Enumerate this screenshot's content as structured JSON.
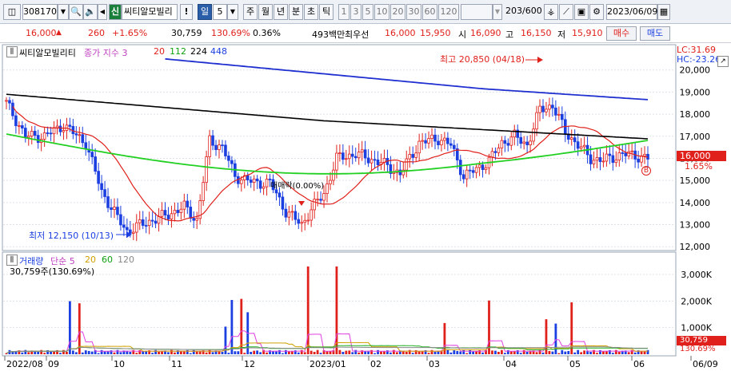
{
  "toolbar": {
    "code": "308170",
    "search_glyph": "🔍",
    "sound_glyph": "🔈",
    "arrow_glyph": "◀",
    "badge": "신",
    "stock_name": "씨티알모빌리",
    "excl": "!",
    "period_label": "일",
    "period_value": "5",
    "dropdown_glyph": "▼",
    "periods": [
      "주",
      "월",
      "년",
      "분",
      "초",
      "틱"
    ],
    "intervals": [
      "1",
      "3",
      "5",
      "10",
      "20",
      "30",
      "60",
      "120"
    ],
    "count": "203",
    "count_total": "/600",
    "date": "2023/06/09",
    "calendar_glyph": "▦"
  },
  "quote": {
    "price": "16,000",
    "up_glyph": "▲",
    "change": "260",
    "change_pct": "+1.65%",
    "volume": "30,759",
    "volume_ratio": "130.69%",
    "turnover": "0.36%",
    "value": "493백만",
    "pref_label": "최우선",
    "ask": "16,000",
    "bid": "15,950",
    "open_label": "시",
    "open": "16,090",
    "high_label": "고",
    "high": "16,150",
    "low_label": "저",
    "low": "15,910",
    "buy": "매수",
    "sell": "매도"
  },
  "price_panel": {
    "legend_name": "씨티알모빌리티",
    "legend_ma_label": "종가 지수 3",
    "ma_periods": [
      "20",
      "112",
      "224",
      "448"
    ],
    "lc": "LC:31.69",
    "hc": "HC:-23.26",
    "high_annot": "최고 20,850 (04/18)",
    "low_annot": "최저 12,150 (10/13)",
    "mid_annot": "매매락(0.00%)",
    "marker_b": "B",
    "cur_price_tag": "16,000",
    "cur_pct_tag": "1.65%"
  },
  "volume_panel": {
    "legend_name": "거래량",
    "legend_ma_label": "단순 5",
    "ma_periods": [
      "20",
      "60",
      "120"
    ],
    "summary": "30,759주(130.69%)",
    "cur_vol_tag": "30,759",
    "cur_pct_tag": "130.69%"
  },
  "x_axis": {
    "labels": [
      "2022/08",
      "09",
      "10",
      "11",
      "12",
      "2023/01",
      "02",
      "03",
      "04",
      "05",
      "06",
      "06/09"
    ]
  },
  "colors": {
    "up": "#e0201b",
    "down": "#1b3fe0",
    "ma20": "#e0201b",
    "ma112": "#22d022",
    "ma224": "#000000",
    "ma448": "#1f2fd0",
    "vma5": "#e040e0",
    "vma20": "#d0a000",
    "vma60": "#22b022",
    "vma120": "#888888"
  },
  "chart_data": {
    "type": "candlestick",
    "y_price_ticks": [
      20000,
      19000,
      18000,
      17000,
      16000,
      15000,
      14000,
      13000,
      12000
    ],
    "y_price_range": [
      11900,
      21000
    ],
    "y_volume_ticks": [
      "3,000K",
      "2,000K",
      "1,000K"
    ],
    "y_volume_range": [
      0,
      3600000
    ],
    "summary_points": {
      "high": 20850,
      "high_date": "04/18",
      "low": 12150,
      "low_date": "10/13",
      "last_close": 16000,
      "last_volume": 30759
    }
  }
}
